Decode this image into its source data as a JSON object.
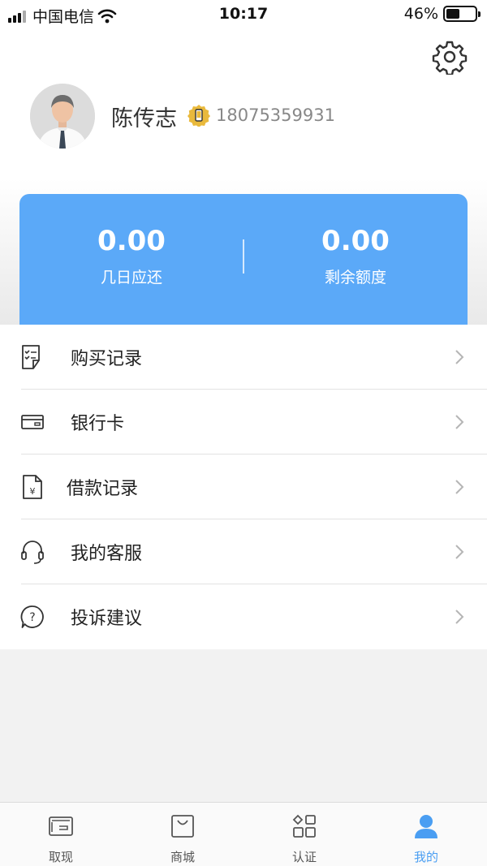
{
  "status_bar": {
    "carrier": "中国电信",
    "time": "10:17",
    "battery_percent": "46%",
    "battery_level": 0.46
  },
  "profile": {
    "name": "陈传志",
    "phone": "18075359931"
  },
  "summary_card": {
    "left": {
      "amount": "0.00",
      "label": "几日应还"
    },
    "right": {
      "amount": "0.00",
      "label": "剩余额度"
    },
    "color": "#5ba9f8"
  },
  "menu": {
    "items": [
      {
        "label": "购买记录",
        "icon": "purchase-record-icon"
      },
      {
        "label": "银行卡",
        "icon": "bank-card-icon"
      },
      {
        "label": "借款记录",
        "icon": "loan-record-icon"
      },
      {
        "label": "我的客服",
        "icon": "headset-icon"
      },
      {
        "label": "投诉建议",
        "icon": "question-icon"
      }
    ]
  },
  "tabbar": {
    "active_color": "#4a9ef2",
    "tabs": [
      {
        "label": "取现",
        "icon": "wallet-icon"
      },
      {
        "label": "商城",
        "icon": "shopping-bag-icon"
      },
      {
        "label": "认证",
        "icon": "grid-icon"
      },
      {
        "label": "我的",
        "icon": "user-icon",
        "active": true
      }
    ]
  }
}
